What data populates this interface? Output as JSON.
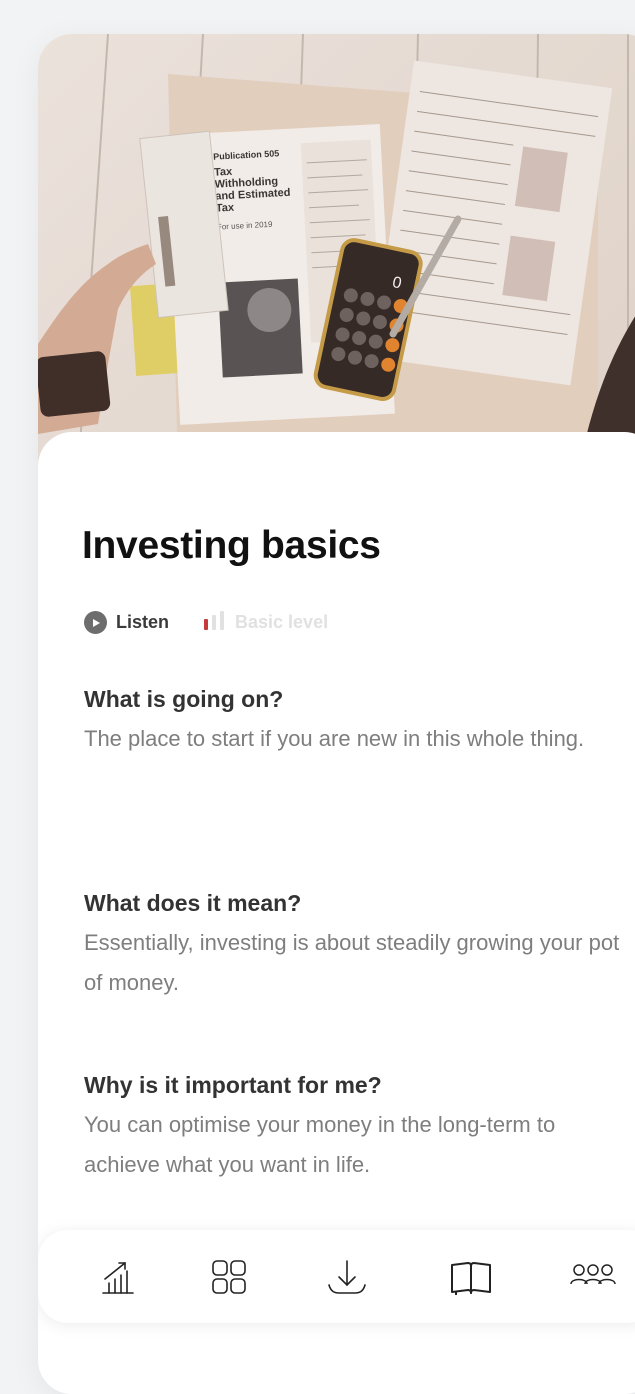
{
  "article": {
    "title": "Investing basics",
    "listen_label": "Listen",
    "level_label": "Basic level"
  },
  "sections": [
    {
      "heading": "What is going on?",
      "body": "The place to start if you are new in this whole thing."
    },
    {
      "heading": "What does it mean?",
      "body": "Essentially, investing is about steadily growing your pot of money."
    },
    {
      "heading": "Why is it important for me?",
      "body": "You can optimise your money in the long-term to achieve what you want in life."
    }
  ],
  "hero_image": {
    "form_title": "Tax Withholding and Estimated Tax",
    "form_year": "For use in 2019",
    "calculator_display": "0"
  },
  "level": {
    "value": 1,
    "max": 3
  },
  "nav": {
    "items": [
      {
        "icon": "growth-chart-icon"
      },
      {
        "icon": "grid-icon"
      },
      {
        "icon": "download-icon"
      },
      {
        "icon": "book-icon"
      },
      {
        "icon": "community-icon"
      }
    ]
  },
  "colors": {
    "background": "#f1f3f5",
    "card": "#ffffff",
    "title": "#111111",
    "body_text": "#7e7e7e",
    "level_active": "#c53a3a",
    "level_inactive": "#e1e1e1"
  }
}
